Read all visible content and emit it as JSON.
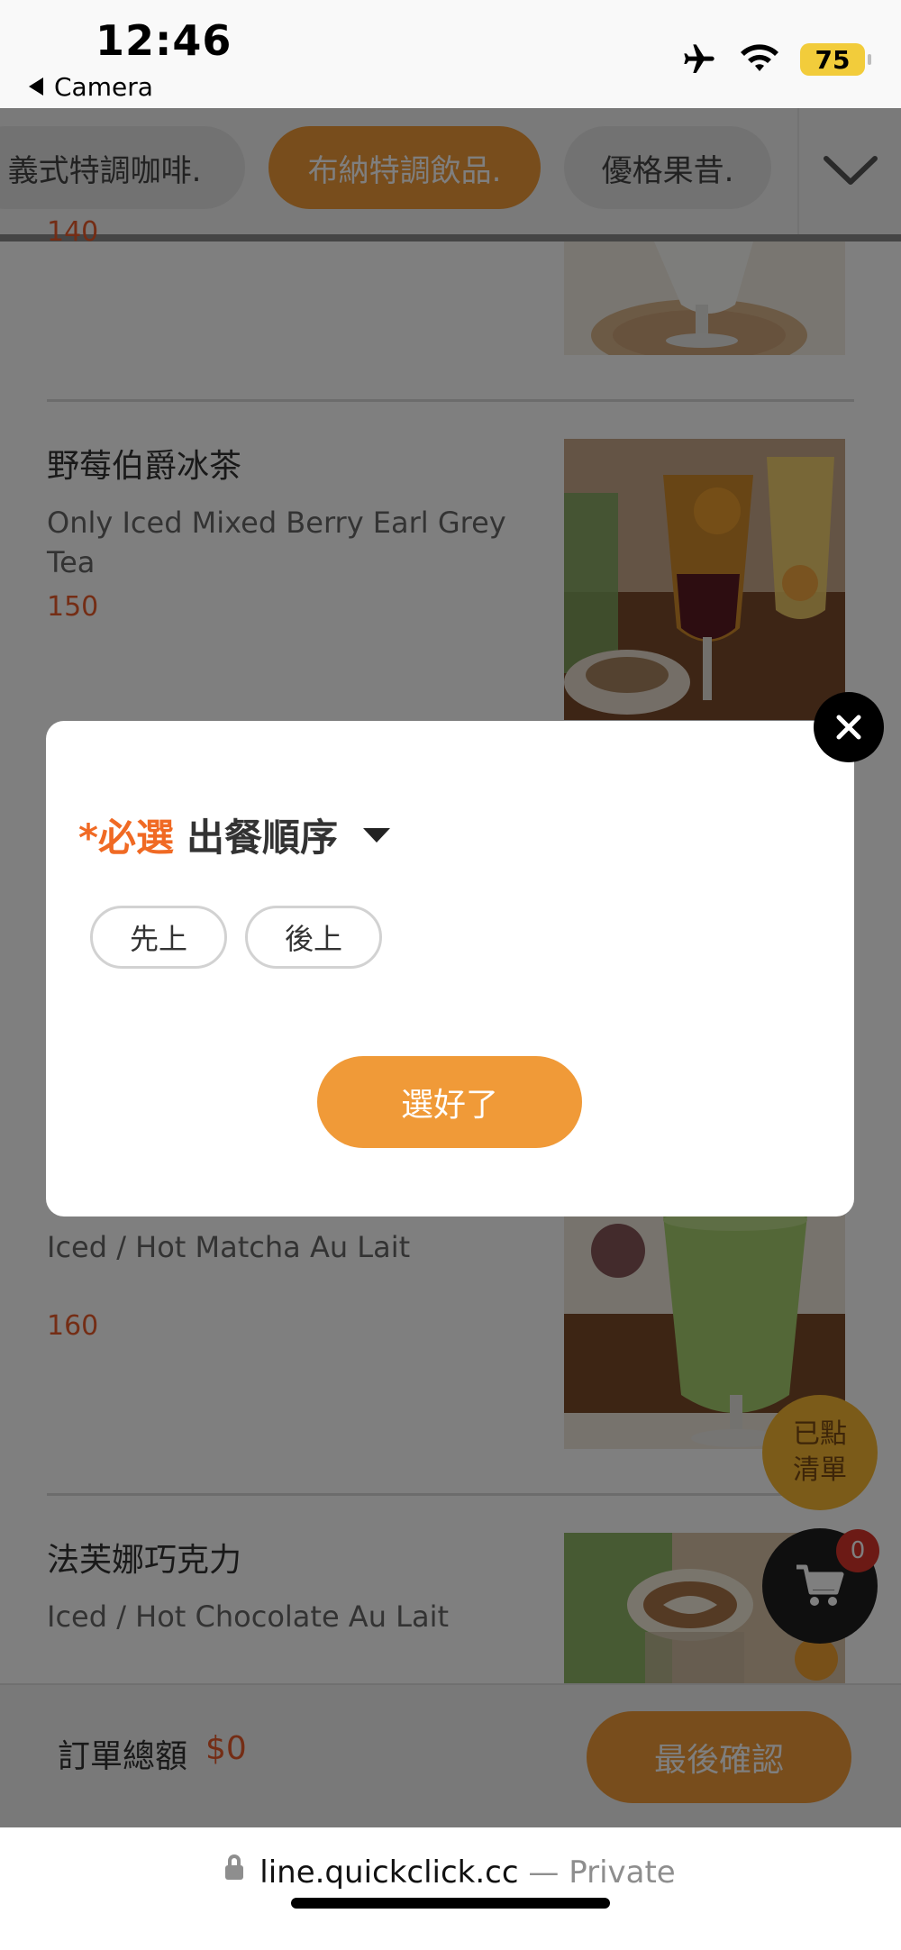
{
  "status_bar": {
    "time": "12:46",
    "back_app": "Camera",
    "battery": "75"
  },
  "categories": [
    {
      "label": "義式特調咖啡."
    },
    {
      "label": "布納特調飲品."
    },
    {
      "label": "優格果昔."
    }
  ],
  "menu": {
    "items": [
      {
        "price": "140"
      },
      {
        "name": "野莓伯爵冰茶",
        "en": "Only Iced Mixed Berry Earl Grey Tea",
        "price": "150"
      },
      {
        "en": "Iced / Hot  Matcha Au Lait",
        "price": "160"
      },
      {
        "name": "法芙娜巧克力",
        "en": "Iced / Hot Chocolate Au Lait"
      }
    ]
  },
  "modal": {
    "required_mark": "*必選",
    "option_group": "出餐順序",
    "options": [
      "先上",
      "後上"
    ],
    "ok_label": "選好了"
  },
  "floating": {
    "list_line1": "已點",
    "list_line2": "清單",
    "cart_count": "0"
  },
  "bottom_bar": {
    "total_label": "訂單總額",
    "total_value": "$0",
    "confirm_label": "最後確認"
  },
  "browser": {
    "url": "line.quickclick.cc",
    "mode": "Private"
  },
  "colors": {
    "accent": "#f09a38",
    "price": "#e85a2a",
    "required": "#f06a24"
  }
}
